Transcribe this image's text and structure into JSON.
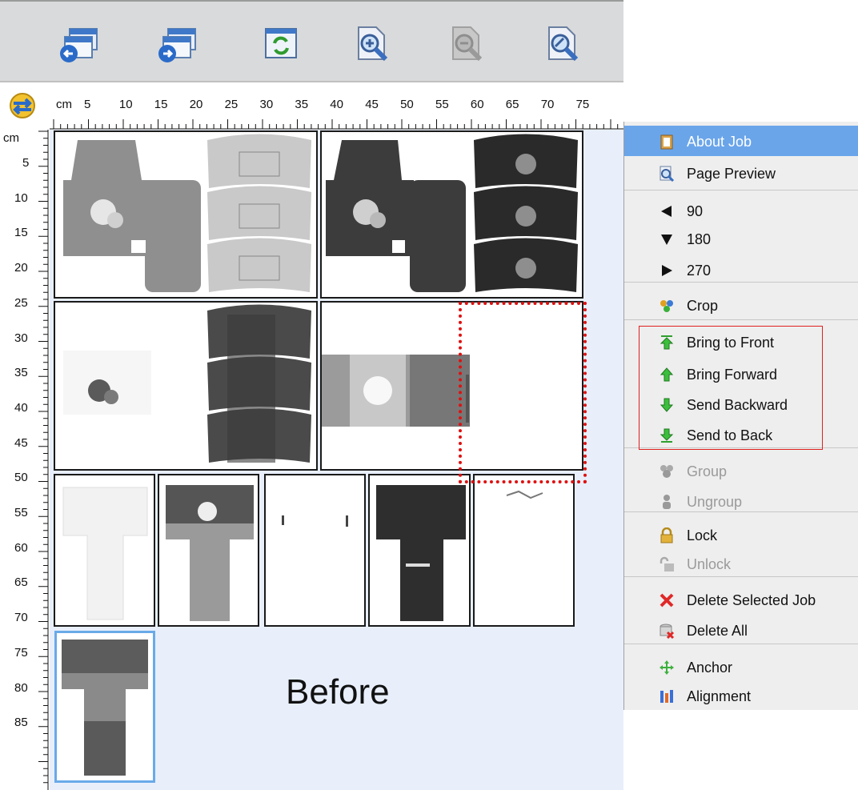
{
  "toolbar": {
    "buttons": [
      {
        "name": "import-job-button",
        "icon": "window-arrow-left-icon"
      },
      {
        "name": "export-job-button",
        "icon": "window-arrow-right-icon"
      },
      {
        "name": "refresh-button",
        "icon": "refresh-icon"
      },
      {
        "name": "zoom-in-button",
        "icon": "zoom-in-icon"
      },
      {
        "name": "zoom-out-button",
        "icon": "zoom-out-icon",
        "disabled": true
      },
      {
        "name": "zoom-fit-button",
        "icon": "zoom-fit-icon"
      }
    ]
  },
  "ruler": {
    "unit": "cm",
    "h_labels": [
      "5",
      "10",
      "15",
      "20",
      "25",
      "30",
      "35",
      "40",
      "45",
      "50",
      "55",
      "60",
      "65",
      "70",
      "75"
    ],
    "v_labels": [
      "5",
      "10",
      "15",
      "20",
      "25",
      "30",
      "35",
      "40",
      "45",
      "50",
      "55",
      "60",
      "65",
      "70",
      "75",
      "80",
      "85"
    ]
  },
  "canvas": {
    "caption": "Before"
  },
  "menu": {
    "items": [
      {
        "label": "About Job",
        "icon": "clipboard-icon",
        "highlighted": true
      },
      {
        "label": "Page Preview",
        "icon": "page-preview-icon"
      },
      {
        "label": "90",
        "icon": "arrow-left-icon"
      },
      {
        "label": "180",
        "icon": "arrow-down-icon"
      },
      {
        "label": "270",
        "icon": "arrow-right-icon"
      },
      {
        "label": "Crop",
        "icon": "crop-icon"
      },
      {
        "label": "Bring to Front",
        "icon": "bring-to-front-icon"
      },
      {
        "label": "Bring Forward",
        "icon": "bring-forward-icon"
      },
      {
        "label": "Send Backward",
        "icon": "send-backward-icon"
      },
      {
        "label": "Send to Back",
        "icon": "send-to-back-icon"
      },
      {
        "label": "Group",
        "icon": "group-icon",
        "disabled": true
      },
      {
        "label": "Ungroup",
        "icon": "ungroup-icon",
        "disabled": true
      },
      {
        "label": "Lock",
        "icon": "lock-icon"
      },
      {
        "label": "Unlock",
        "icon": "unlock-icon",
        "disabled": true
      },
      {
        "label": "Delete Selected Job",
        "icon": "delete-x-icon"
      },
      {
        "label": "Delete All",
        "icon": "delete-all-icon"
      },
      {
        "label": "Anchor",
        "icon": "anchor-move-icon"
      },
      {
        "label": "Alignment",
        "icon": "alignment-icon"
      }
    ]
  },
  "colors": {
    "menu_highlight": "#6aa5ea",
    "canvas_bg": "#e8effb",
    "selection_border": "#6aaae8",
    "annotation_red": "#e01010"
  }
}
